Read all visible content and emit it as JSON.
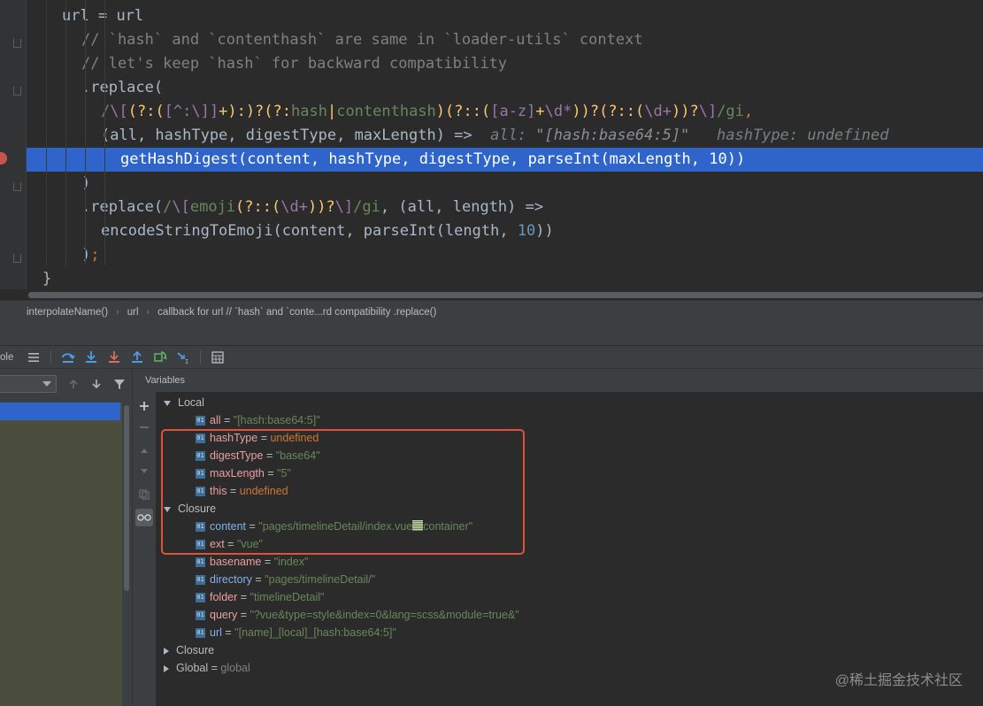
{
  "editor": {
    "lines": [
      [
        {
          "t": "url ",
          "c": ""
        },
        {
          "t": "=",
          "c": ""
        },
        {
          "t": " url",
          "c": ""
        }
      ],
      [
        {
          "t": "// `hash` and `contenthash` are same in `loader-utils` context",
          "c": "c-cmt"
        }
      ],
      [
        {
          "t": "// let's keep `hash` for backward compatibility",
          "c": "c-cmt"
        }
      ],
      [
        {
          "t": ".replace(",
          "c": ""
        }
      ],
      [
        {
          "t": "/",
          "c": "c-rx"
        },
        {
          "t": "\\[",
          "c": "c-rxb"
        },
        {
          "t": "(?:(",
          "c": "c-fn"
        },
        {
          "t": "[^:\\]]",
          "c": "c-rxb"
        },
        {
          "t": "+):)?(?:",
          "c": "c-fn"
        },
        {
          "t": "hash",
          "c": "c-rx"
        },
        {
          "t": "|",
          "c": "c-fn"
        },
        {
          "t": "contenthash",
          "c": "c-rx"
        },
        {
          "t": ")(?::(",
          "c": "c-fn"
        },
        {
          "t": "[a-z]",
          "c": "c-rxb"
        },
        {
          "t": "+",
          "c": "c-fn"
        },
        {
          "t": "\\d*",
          "c": "c-rxb"
        },
        {
          "t": "))?(?::(",
          "c": "c-fn"
        },
        {
          "t": "\\d+",
          "c": "c-rxb"
        },
        {
          "t": "))?",
          "c": "c-fn"
        },
        {
          "t": "\\]",
          "c": "c-rxb"
        },
        {
          "t": "/gi",
          "c": "c-rx"
        },
        {
          "t": ",",
          "c": "c-kw"
        }
      ],
      [
        {
          "t": "(all, hashType, digestType, maxLength) =>",
          "c": ""
        },
        {
          "t": "  all: ",
          "c": "c-inl"
        },
        {
          "t": "\"[hash:base64:5]\"",
          "c": "c-inls"
        },
        {
          "t": "   hashType: undefined",
          "c": "c-inl"
        }
      ],
      [
        {
          "t": "getHashDigest(content, hashType, digestType, parseInt(maxLength, ",
          "c": ""
        },
        {
          "t": "10",
          "c": "c-num"
        },
        {
          "t": "))",
          "c": ""
        }
      ],
      [
        {
          "t": ")",
          "c": ""
        }
      ],
      [
        {
          "t": ".replace(",
          "c": ""
        },
        {
          "t": "/",
          "c": "c-rx"
        },
        {
          "t": "\\[",
          "c": "c-rxb"
        },
        {
          "t": "emoji",
          "c": "c-rx"
        },
        {
          "t": "(?::(",
          "c": "c-fn"
        },
        {
          "t": "\\d+",
          "c": "c-rxb"
        },
        {
          "t": "))?",
          "c": "c-fn"
        },
        {
          "t": "\\]",
          "c": "c-rxb"
        },
        {
          "t": "/gi",
          "c": "c-rx"
        },
        {
          "t": ", (all, length) =>",
          "c": ""
        }
      ],
      [
        {
          "t": "encodeStringToEmoji(content, parseInt(length, ",
          "c": ""
        },
        {
          "t": "10",
          "c": "c-num"
        },
        {
          "t": "))",
          "c": ""
        }
      ],
      [
        {
          "t": ")",
          "c": ""
        },
        {
          "t": ";",
          "c": "c-kw"
        }
      ],
      [
        {
          "t": "}",
          "c": ""
        }
      ]
    ]
  },
  "breadcrumb": [
    "interpolateName()",
    "url",
    "callback for url // `hash` and `conte...rd compatibility .replace()"
  ],
  "toolbar": {
    "console_label": "ole"
  },
  "variables": {
    "header": "Variables",
    "groups": [
      {
        "label": "Local",
        "expanded": true
      },
      {
        "label": "Closure",
        "expanded": true
      },
      {
        "label": "Closure",
        "expanded": false
      },
      {
        "label": "Global",
        "value": "global",
        "expanded": false
      }
    ],
    "items": [
      {
        "name": "all",
        "value": "\"[hash:base64:5]\"",
        "kind": "str",
        "color": "red"
      },
      {
        "name": "hashType",
        "value": "undefined",
        "kind": "und",
        "color": "red"
      },
      {
        "name": "digestType",
        "value": "\"base64\"",
        "kind": "str",
        "color": "red"
      },
      {
        "name": "maxLength",
        "value": "\"5\"",
        "kind": "str",
        "color": "red"
      },
      {
        "name": "this",
        "value": "undefined",
        "kind": "und",
        "color": "red"
      },
      {
        "name": "content",
        "value_a": "\"pages/timelineDetail/index.vue",
        "value_b": "container\"",
        "kind": "str",
        "color": "blue"
      },
      {
        "name": "ext",
        "value": "\"vue\"",
        "kind": "str",
        "color": "red"
      },
      {
        "name": "basename",
        "value": "\"index\"",
        "kind": "str",
        "color": "red"
      },
      {
        "name": "directory",
        "value": "\"pages/timelineDetail/\"",
        "kind": "str",
        "color": "blue"
      },
      {
        "name": "folder",
        "value": "\"timelineDetail\"",
        "kind": "str",
        "color": "red"
      },
      {
        "name": "query",
        "value": "\"?vue&type=style&index=0&lang=scss&module=true&\"",
        "kind": "str",
        "color": "red"
      },
      {
        "name": "url",
        "value": "\"[name]_[local]_[hash:base64:5]\"",
        "kind": "str",
        "color": "blue"
      }
    ]
  },
  "watermark": "@稀土掘金技术社区",
  "icons": {
    "toolbar": [
      "menu-icon",
      "step-over-icon",
      "step-into-icon",
      "force-step-into-icon",
      "step-out-icon",
      "restart-frame-icon",
      "run-to-cursor-icon",
      "evaluate-icon"
    ],
    "frames": [
      "frames-up-icon",
      "frames-down-icon",
      "filter-icon"
    ],
    "side": [
      "add-watch-icon",
      "remove-watch-icon",
      "move-up-icon",
      "move-down-icon",
      "copy-icon",
      "glasses-icon"
    ]
  },
  "colors": {
    "execution_line": "#2f65ca",
    "highlight_box": "#e0513b"
  }
}
